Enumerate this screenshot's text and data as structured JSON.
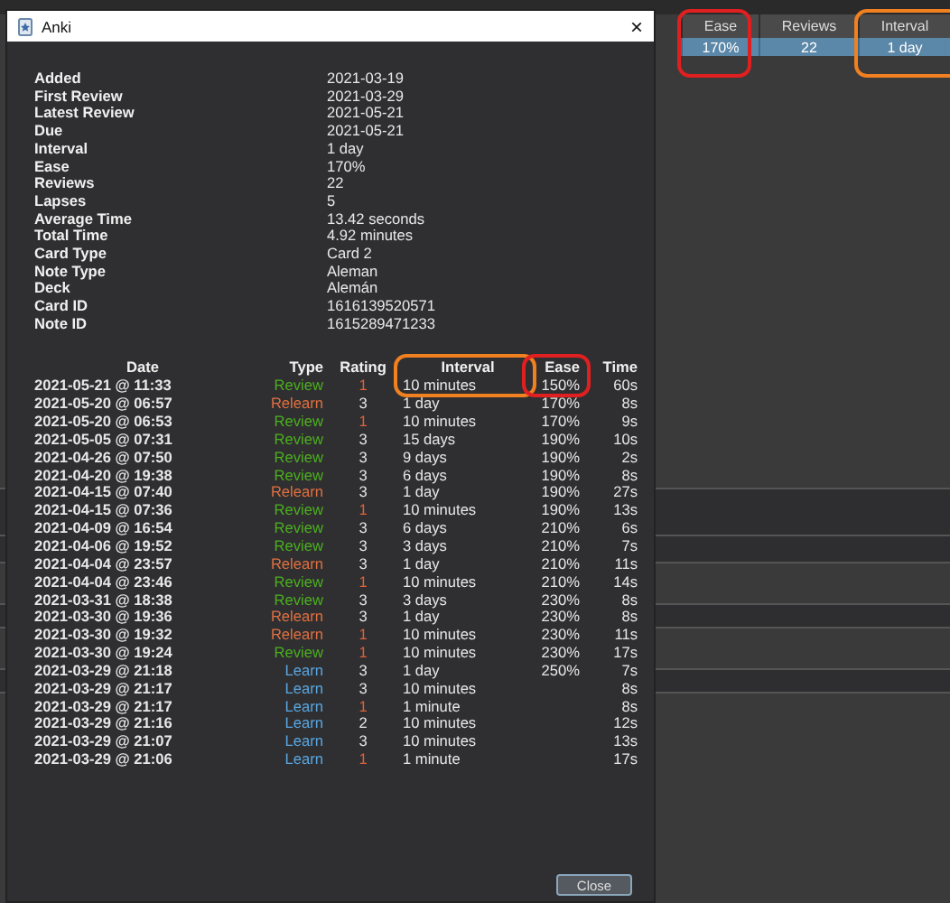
{
  "browser": {
    "columns": [
      {
        "label": "Ease",
        "color": "#e02020"
      },
      {
        "label": "Reviews"
      },
      {
        "label": "Interval",
        "color": "#f08020"
      }
    ],
    "selected_row": {
      "selected": true,
      "cells": [
        "170%",
        "22",
        "1 day"
      ]
    }
  },
  "dialog": {
    "title": "Anki",
    "close_symbol": "×",
    "info": [
      {
        "label": "Added",
        "value": "2021-03-19"
      },
      {
        "label": "First Review",
        "value": "2021-03-29"
      },
      {
        "label": "Latest Review",
        "value": "2021-05-21"
      },
      {
        "label": "Due",
        "value": "2021-05-21"
      },
      {
        "label": "Interval",
        "value": "1 day"
      },
      {
        "label": "Ease",
        "value": "170%"
      },
      {
        "label": "Reviews",
        "value": "22"
      },
      {
        "label": "Lapses",
        "value": "5"
      },
      {
        "label": "Average Time",
        "value": "13.42 seconds"
      },
      {
        "label": "Total Time",
        "value": "4.92 minutes"
      },
      {
        "label": "Card Type",
        "value": "Card 2"
      },
      {
        "label": "Note Type",
        "value": "Aleman"
      },
      {
        "label": "Deck",
        "value": "Alemán"
      },
      {
        "label": "Card ID",
        "value": "1616139520571"
      },
      {
        "label": "Note ID",
        "value": "1615289471233"
      }
    ],
    "review_table": {
      "columns": [
        {
          "label": "Date"
        },
        {
          "label": "Type"
        },
        {
          "label": "Rating"
        },
        {
          "label": "Interval",
          "color": "#f08020"
        },
        {
          "label": "Ease",
          "color": "#e02020"
        },
        {
          "label": "Time"
        }
      ],
      "rows": [
        {
          "date": "2021-05-21 @ 11:33",
          "type": {
            "text": "Review",
            "color": "#4caf1f"
          },
          "rating": {
            "text": "1",
            "color": "#e0603a"
          },
          "interval": "10 minutes",
          "ease": "150%",
          "time": "60s"
        },
        {
          "date": "2021-05-20 @ 06:57",
          "type": {
            "text": "Relearn",
            "color": "#e07040"
          },
          "rating": {
            "text": "3",
            "color": "#e8e8e8"
          },
          "interval": "1 day",
          "ease": "170%",
          "time": "8s"
        },
        {
          "date": "2021-05-20 @ 06:53",
          "type": {
            "text": "Review",
            "color": "#4caf1f"
          },
          "rating": {
            "text": "1",
            "color": "#e0603a"
          },
          "interval": "10 minutes",
          "ease": "170%",
          "time": "9s"
        },
        {
          "date": "2021-05-05 @ 07:31",
          "type": {
            "text": "Review",
            "color": "#4caf1f"
          },
          "rating": {
            "text": "3",
            "color": "#e8e8e8"
          },
          "interval": "15 days",
          "ease": "190%",
          "time": "10s"
        },
        {
          "date": "2021-04-26 @ 07:50",
          "type": {
            "text": "Review",
            "color": "#4caf1f"
          },
          "rating": {
            "text": "3",
            "color": "#e8e8e8"
          },
          "interval": "9 days",
          "ease": "190%",
          "time": "2s"
        },
        {
          "date": "2021-04-20 @ 19:38",
          "type": {
            "text": "Review",
            "color": "#4caf1f"
          },
          "rating": {
            "text": "3",
            "color": "#e8e8e8"
          },
          "interval": "6 days",
          "ease": "190%",
          "time": "8s"
        },
        {
          "date": "2021-04-15 @ 07:40",
          "type": {
            "text": "Relearn",
            "color": "#e07040"
          },
          "rating": {
            "text": "3",
            "color": "#e8e8e8"
          },
          "interval": "1 day",
          "ease": "190%",
          "time": "27s"
        },
        {
          "date": "2021-04-15 @ 07:36",
          "type": {
            "text": "Review",
            "color": "#4caf1f"
          },
          "rating": {
            "text": "1",
            "color": "#e0603a"
          },
          "interval": "10 minutes",
          "ease": "190%",
          "time": "13s"
        },
        {
          "date": "2021-04-09 @ 16:54",
          "type": {
            "text": "Review",
            "color": "#4caf1f"
          },
          "rating": {
            "text": "3",
            "color": "#e8e8e8"
          },
          "interval": "6 days",
          "ease": "210%",
          "time": "6s"
        },
        {
          "date": "2021-04-06 @ 19:52",
          "type": {
            "text": "Review",
            "color": "#4caf1f"
          },
          "rating": {
            "text": "3",
            "color": "#e8e8e8"
          },
          "interval": "3 days",
          "ease": "210%",
          "time": "7s"
        },
        {
          "date": "2021-04-04 @ 23:57",
          "type": {
            "text": "Relearn",
            "color": "#e07040"
          },
          "rating": {
            "text": "3",
            "color": "#e8e8e8"
          },
          "interval": "1 day",
          "ease": "210%",
          "time": "11s"
        },
        {
          "date": "2021-04-04 @ 23:46",
          "type": {
            "text": "Review",
            "color": "#4caf1f"
          },
          "rating": {
            "text": "1",
            "color": "#e0603a"
          },
          "interval": "10 minutes",
          "ease": "210%",
          "time": "14s"
        },
        {
          "date": "2021-03-31 @ 18:38",
          "type": {
            "text": "Review",
            "color": "#4caf1f"
          },
          "rating": {
            "text": "3",
            "color": "#e8e8e8"
          },
          "interval": "3 days",
          "ease": "230%",
          "time": "8s"
        },
        {
          "date": "2021-03-30 @ 19:36",
          "type": {
            "text": "Relearn",
            "color": "#e07040"
          },
          "rating": {
            "text": "3",
            "color": "#e8e8e8"
          },
          "interval": "1 day",
          "ease": "230%",
          "time": "8s"
        },
        {
          "date": "2021-03-30 @ 19:32",
          "type": {
            "text": "Relearn",
            "color": "#e07040"
          },
          "rating": {
            "text": "1",
            "color": "#e0603a"
          },
          "interval": "10 minutes",
          "ease": "230%",
          "time": "11s"
        },
        {
          "date": "2021-03-30 @ 19:24",
          "type": {
            "text": "Review",
            "color": "#4caf1f"
          },
          "rating": {
            "text": "1",
            "color": "#e0603a"
          },
          "interval": "10 minutes",
          "ease": "230%",
          "time": "17s"
        },
        {
          "date": "2021-03-29 @ 21:18",
          "type": {
            "text": "Learn",
            "color": "#5aa6e0"
          },
          "rating": {
            "text": "3",
            "color": "#e8e8e8"
          },
          "interval": "1 day",
          "ease": "250%",
          "time": "7s"
        },
        {
          "date": "2021-03-29 @ 21:17",
          "type": {
            "text": "Learn",
            "color": "#5aa6e0"
          },
          "rating": {
            "text": "3",
            "color": "#e8e8e8"
          },
          "interval": "10 minutes",
          "ease": null,
          "time": "8s"
        },
        {
          "date": "2021-03-29 @ 21:17",
          "type": {
            "text": "Learn",
            "color": "#5aa6e0"
          },
          "rating": {
            "text": "1",
            "color": "#e0603a"
          },
          "interval": "1 minute",
          "ease": null,
          "time": "8s"
        },
        {
          "date": "2021-03-29 @ 21:16",
          "type": {
            "text": "Learn",
            "color": "#5aa6e0"
          },
          "rating": {
            "text": "2",
            "color": "#e8e8e8"
          },
          "interval": "10 minutes",
          "ease": null,
          "time": "12s"
        },
        {
          "date": "2021-03-29 @ 21:07",
          "type": {
            "text": "Learn",
            "color": "#5aa6e0"
          },
          "rating": {
            "text": "3",
            "color": "#e8e8e8"
          },
          "interval": "10 minutes",
          "ease": null,
          "time": "13s"
        },
        {
          "date": "2021-03-29 @ 21:06",
          "type": {
            "text": "Learn",
            "color": "#5aa6e0"
          },
          "rating": {
            "text": "1",
            "color": "#e0603a"
          },
          "interval": "1 minute",
          "ease": null,
          "time": "17s"
        }
      ]
    },
    "buttons": [
      {
        "label": "Close"
      }
    ]
  }
}
